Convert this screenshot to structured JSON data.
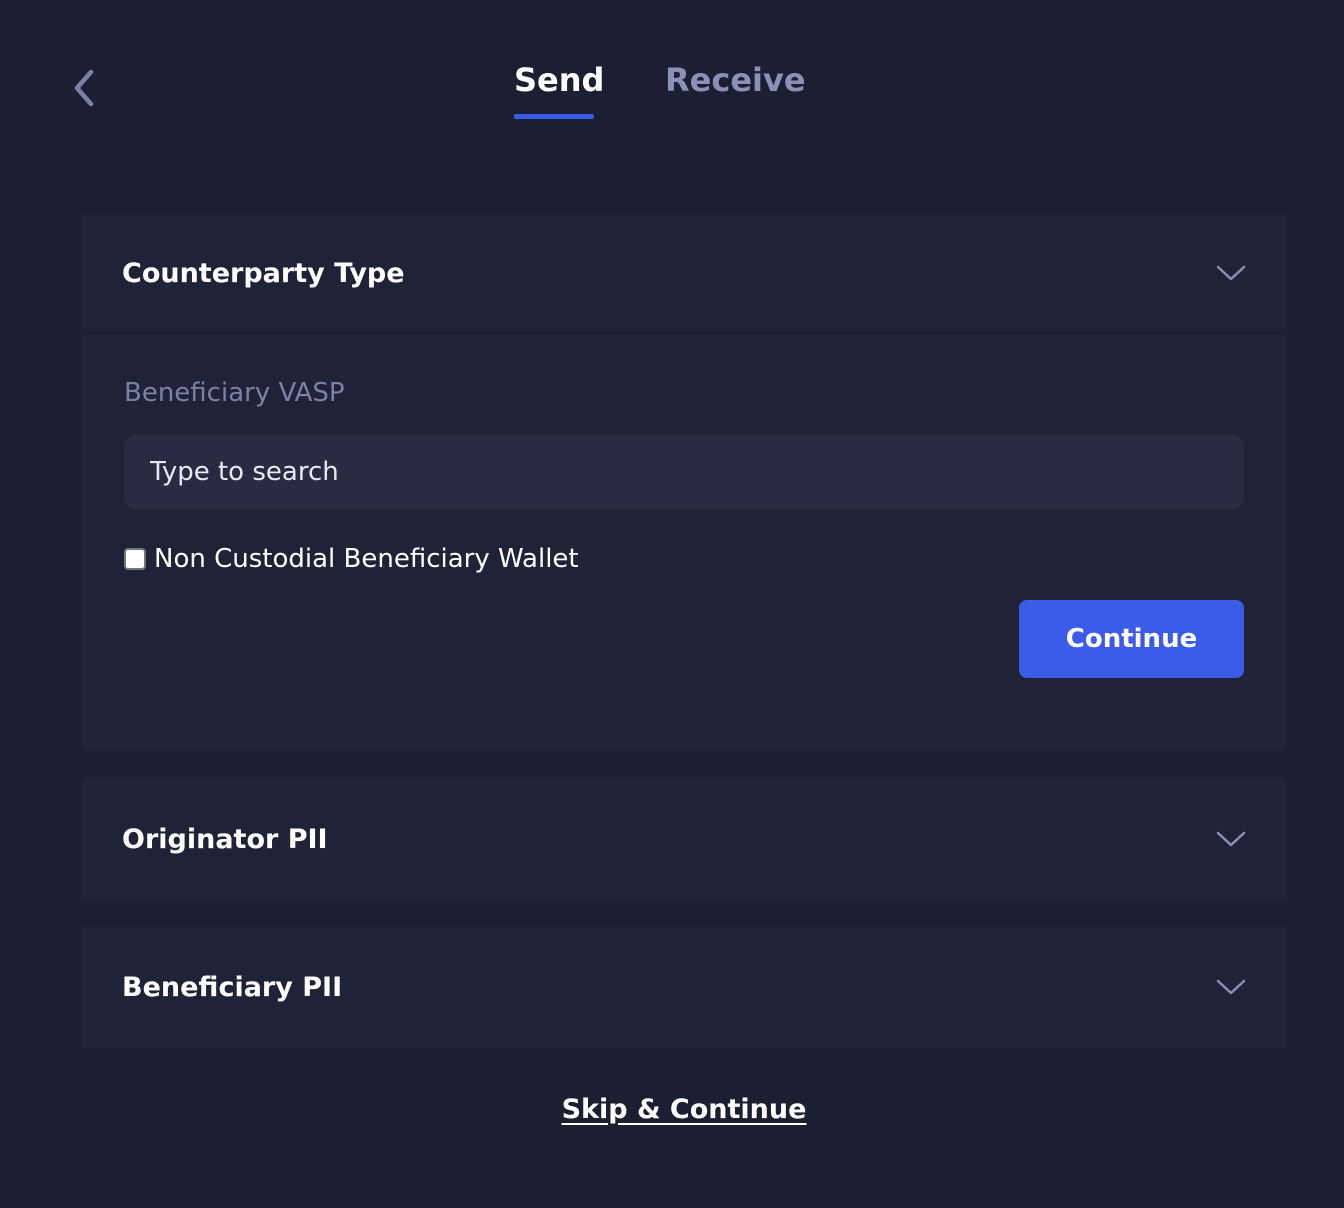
{
  "nav": {
    "back_icon": "chevron-left-icon"
  },
  "tabs": [
    {
      "label": "Send",
      "active": true
    },
    {
      "label": "Receive",
      "active": false
    }
  ],
  "colors": {
    "background": "#1c1f31",
    "panel": "#202337",
    "accent": "#3b5ce8",
    "muted_text": "#7a80a6",
    "inactive_tab": "#8a90b8"
  },
  "sections": {
    "counterparty": {
      "title": "Counterparty Type",
      "expanded": true,
      "field_label": "Beneficiary VASP",
      "search_placeholder": "Type to search",
      "search_value": "",
      "checkbox_label": "Non Custodial Beneficiary Wallet",
      "checkbox_checked": false,
      "continue_label": "Continue"
    },
    "originator": {
      "title": "Originator PII",
      "expanded": false
    },
    "beneficiary": {
      "title": "Beneficiary PII",
      "expanded": false
    }
  },
  "footer": {
    "skip_label": "Skip & Continue"
  }
}
